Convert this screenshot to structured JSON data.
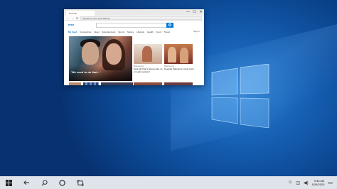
{
  "browser": {
    "tab_title": "New tab",
    "address": "Search or enter web address",
    "window_controls": [
      "—",
      "☐",
      "✕"
    ],
    "nav_glyphs": [
      "←",
      "→",
      "⟳"
    ],
    "logo_text": "msn",
    "user_text": "Sign in",
    "nav_items": [
      "My Feed",
      "Coronavirus",
      "News",
      "Entertainment",
      "Sports",
      "Money",
      "Lifestyle",
      "Health",
      "Food",
      "Travel"
    ],
    "hero_caption": "'We need to do that…'",
    "card_left": {
      "source": "Bollywood",
      "text": "Sara Ali Khan's fitness take on a tough weekend"
    },
    "card_right": {
      "source": "Bollywood",
      "text": "Deepika Padukone's look stuns"
    }
  },
  "taskbar": {
    "start_icon": "windows-logo-icon",
    "back_icon": "back-arrow-icon",
    "search_icon": "search-icon",
    "cortana_icon": "cortana-circle-icon",
    "taskview_icon": "task-view-icon",
    "time": "9:38 AM",
    "date": "9/28/2020"
  },
  "colors": {
    "accent": "#0078d7",
    "desktop": "#1760b4",
    "taskbar": "#dfe3ea"
  }
}
